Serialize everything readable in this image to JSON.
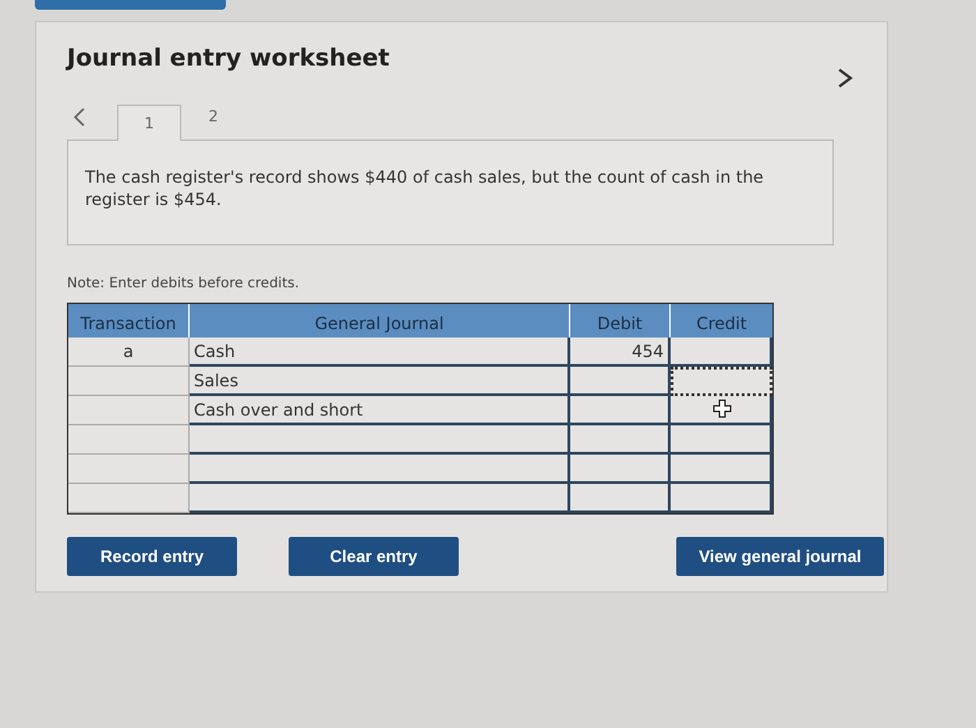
{
  "title": "Journal entry worksheet",
  "tabs": [
    {
      "label": "1",
      "selected": true
    },
    {
      "label": "2",
      "selected": false
    }
  ],
  "prompt": "The cash register's record shows $440 of cash sales, but the count of cash in the register is $454.",
  "note": "Note: Enter debits before credits.",
  "table": {
    "columns": [
      "Transaction",
      "General Journal",
      "Debit",
      "Credit"
    ],
    "rows": [
      {
        "transaction": "a",
        "account": "Cash",
        "debit": "454",
        "credit_focused": false
      },
      {
        "transaction": "",
        "account": "Sales",
        "debit": "",
        "credit_focused": true
      },
      {
        "transaction": "",
        "account": "Cash over and short",
        "debit": "",
        "credit_focused": false
      },
      {
        "transaction": "",
        "account": "",
        "debit": "",
        "credit_focused": false
      },
      {
        "transaction": "",
        "account": "",
        "debit": "",
        "credit_focused": false
      },
      {
        "transaction": "",
        "account": "",
        "debit": "",
        "credit_focused": false
      }
    ]
  },
  "buttons": [
    "Record entry",
    "Clear entry",
    "View general journal"
  ]
}
